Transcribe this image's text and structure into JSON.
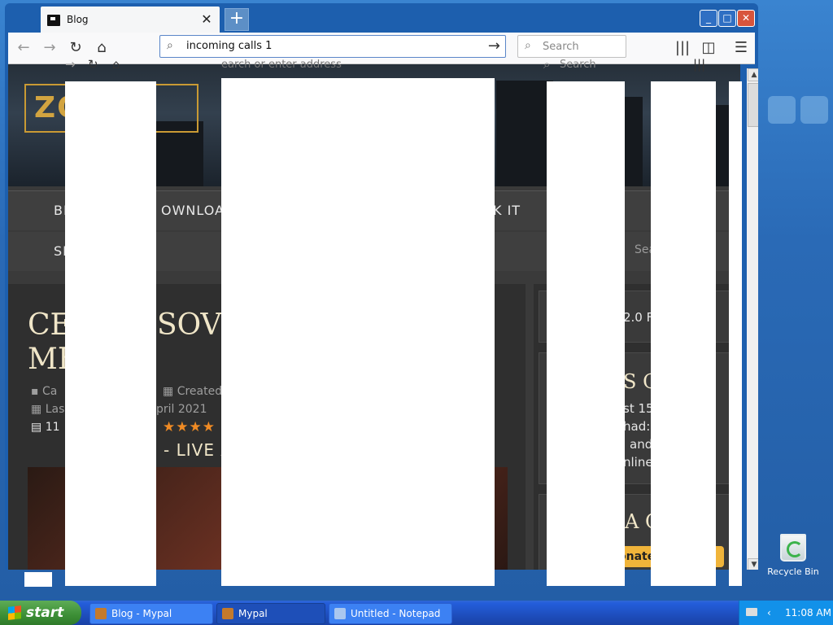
{
  "browser": {
    "tab_title": "Blog",
    "new_tab_label": "+",
    "url_value": "incoming calls 1",
    "url_placeholder": "Search or enter address",
    "search_placeholder": "Search",
    "window_buttons": {
      "minimize": "_",
      "maximize": "□",
      "close": "✕"
    }
  },
  "ghost_nav": {
    "address_placeholder_fragment": "earch or enter address",
    "search_placeholder": "Search"
  },
  "site": {
    "logo_text": "ZO    4",
    "menu_row1": [
      "BL",
      "OWNLOAD",
      "K IT"
    ],
    "menu_row2": [
      "SIG"
    ],
    "site_search_fragment": "Sea",
    "article_title": "CEL     SSOVE\nME",
    "meta_category": "Ca",
    "meta_created": "Created: 2",
    "meta_updated_left": "Las",
    "meta_updated_right": "pril 2021",
    "meta_comments": "11",
    "stars": "★★★★",
    "subhead": "S - LIVE A",
    "sidebar_top": "2.0 Fo",
    "sidebar_heading": "S O",
    "sidebar_line1": "st 15",
    "sidebar_line2": "had:",
    "sidebar_line3": "and",
    "sidebar_line4": "nline",
    "sidebar_heading2": "A C",
    "donate_label": "onate"
  },
  "desktop": {
    "recycle_bin_label": "Recycle Bin"
  },
  "taskbar": {
    "start_label": "start",
    "tasks": [
      {
        "label": "Blog - Mypal"
      },
      {
        "label": "Mypal"
      },
      {
        "label": "Untitled - Notepad"
      }
    ],
    "clock": "11:08 AM"
  }
}
